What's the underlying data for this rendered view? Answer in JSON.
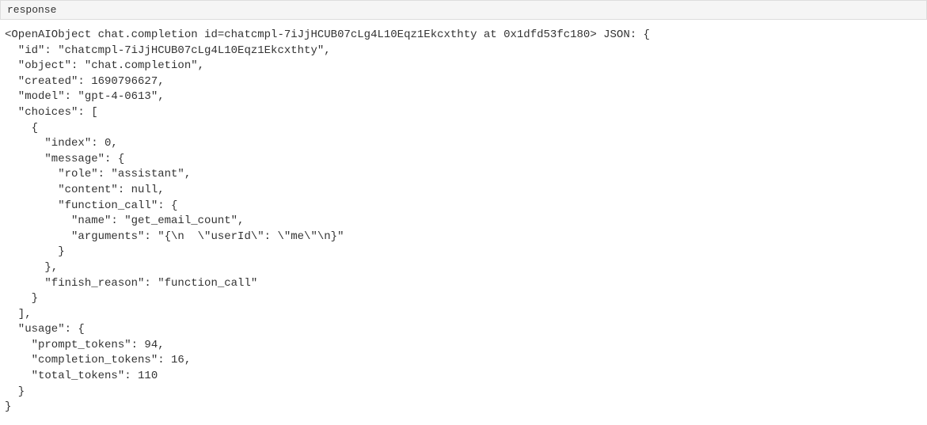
{
  "header": {
    "label": "response"
  },
  "code": {
    "line1": "<OpenAIObject chat.completion id=chatcmpl-7iJjHCUB07cLg4L10Eqz1Ekcxthty at 0x1dfd53fc180> JSON: {",
    "line2": "  \"id\": \"chatcmpl-7iJjHCUB07cLg4L10Eqz1Ekcxthty\",",
    "line3": "  \"object\": \"chat.completion\",",
    "line4": "  \"created\": 1690796627,",
    "line5": "  \"model\": \"gpt-4-0613\",",
    "line6": "  \"choices\": [",
    "line7": "    {",
    "line8": "      \"index\": 0,",
    "line9": "      \"message\": {",
    "line10": "        \"role\": \"assistant\",",
    "line11": "        \"content\": null,",
    "line12": "        \"function_call\": {",
    "line13": "          \"name\": \"get_email_count\",",
    "line14": "          \"arguments\": \"{\\n  \\\"userId\\\": \\\"me\\\"\\n}\"",
    "line15": "        }",
    "line16": "      },",
    "line17": "      \"finish_reason\": \"function_call\"",
    "line18": "    }",
    "line19": "  ],",
    "line20": "  \"usage\": {",
    "line21": "    \"prompt_tokens\": 94,",
    "line22": "    \"completion_tokens\": 16,",
    "line23": "    \"total_tokens\": 110",
    "line24": "  }",
    "line25": "}"
  }
}
